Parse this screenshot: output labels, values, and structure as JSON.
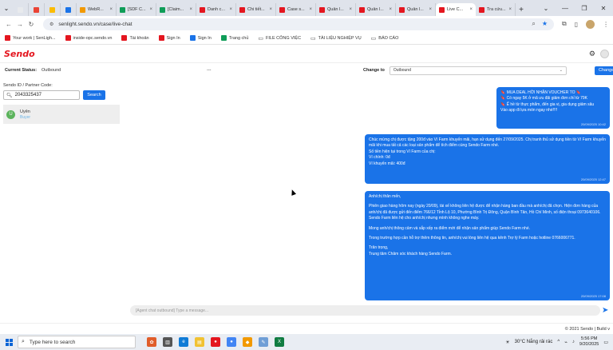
{
  "browser": {
    "tabs": [
      {
        "label": "",
        "color": "#e8eaed",
        "active": false
      },
      {
        "label": "",
        "color": "#ea4335",
        "active": false
      },
      {
        "label": "",
        "color": "#fbbc04",
        "active": false
      },
      {
        "label": "",
        "color": "#1a73e8",
        "active": false
      },
      {
        "label": "WebR...",
        "color": "#f29900",
        "active": false
      },
      {
        "label": "[SDF C...",
        "color": "#0f9d58",
        "active": false
      },
      {
        "label": "[Claim...",
        "color": "#0f9d58",
        "active": false
      },
      {
        "label": "Danh c...",
        "color": "#e4161f",
        "active": false
      },
      {
        "label": "Chi tiết...",
        "color": "#e4161f",
        "active": false
      },
      {
        "label": "Case s...",
        "color": "#e4161f",
        "active": false
      },
      {
        "label": "Quản l...",
        "color": "#e4161f",
        "active": false
      },
      {
        "label": "Quản l...",
        "color": "#e4161f",
        "active": false
      },
      {
        "label": "Quản l...",
        "color": "#e4161f",
        "active": false
      },
      {
        "label": "Live C...",
        "color": "#e4161f",
        "active": true
      },
      {
        "label": "Tra cứu...",
        "color": "#e4161f",
        "active": false
      }
    ],
    "url": "senlight.sendo.vn/case/live-chat",
    "bookmarks": [
      {
        "label": "Your work | SenLigh...",
        "color": "#e4161f",
        "type": "site"
      },
      {
        "label": "inside-opc.sendo.vn",
        "color": "#e4161f",
        "type": "site"
      },
      {
        "label": "Tài khoản",
        "color": "#e4161f",
        "type": "site"
      },
      {
        "label": "Sign In",
        "color": "#e4161f",
        "type": "site"
      },
      {
        "label": "Sign In",
        "color": "#1a73e8",
        "type": "site"
      },
      {
        "label": "Trang chủ",
        "color": "#0f9d58",
        "type": "site"
      },
      {
        "label": "FILE CÔNG VIỆC",
        "color": "#777777",
        "type": "folder"
      },
      {
        "label": "TÀI LIỆU NGHIỆP VỤ",
        "color": "#777777",
        "type": "folder"
      },
      {
        "label": "BÁO CÁO",
        "color": "#777777",
        "type": "folder"
      }
    ]
  },
  "app": {
    "logo": "Sendo",
    "current_status_label": "Current Status:",
    "current_status_value": "Outbound",
    "mid_placeholder": "---",
    "change_to_label": "Change to",
    "change_to_value": "Outbound",
    "change_button": "Change",
    "search": {
      "label": "Sendo ID / Partner Code:",
      "value": "2043325437",
      "button": "Search"
    },
    "contact": {
      "initial": "U",
      "name": "Uyên",
      "role": "Buyer"
    },
    "messages": [
      {
        "lines": [
          "🔖 MUA DEAL HỜI NHẬN VOUCHER TO 🔖",
          "🔖 Có ngay 5K ở mã ưu đãi giảm đơn chỉ từ 79K",
          "🔖 Ế hề từ thực phẩm, đến gia vị, gia dụng giảm sâu",
          "Vào app đi lựa món ngay nhé!!!!"
        ],
        "time": "20/09/2025 10:42"
      },
      {
        "lines": [
          "Chúc mừng chị được tặng 200đ vào Ví Farm khuyến mãi, hạn sử dụng đến 27/09/2025. Chị tranh thủ sử dụng tiền từ Ví Farm khuyến mãi khi mua tất cả các loại sản phẩm để tích điểm cùng Sendo Farm nhé.",
          "Số tiền hiện tại trong Ví Farm của chị:",
          "Ví chính: 0đ",
          "Ví khuyến mãi: 400đ"
        ],
        "time": "20/09/2025 12:47"
      },
      {
        "lines": [
          "Anh/chị thân mến,",
          "",
          "Phiên giao hàng hôm nay (ngày 20/09), tài xế không liên hệ được để nhận hàng ban đầu mà anh/chị đã chọn. Hiện đơn hàng của anh/chị đã được gửi đến điểm 766/12 Tỉnh Lộ 10, Phường Bình Trị Đông, Quận Bình Tân, Hồ Chí Minh, số điện thoại 0973640106. Sendo Farm liên hệ cho anh/chị nhưng mình không nghe máy.",
          "",
          "Mong anh/chị thông cảm và sắp xếp ra điểm mới để nhận sản phẩm giúp Sendo Farm nhé.",
          "",
          "Trong trường hợp cần hỗ trợ thêm thông tin, anh/chị vui lòng liên hệ qua kênh Trợ lý Farm hoặc hotline 0766006771.",
          "",
          "Trân trọng,",
          "Trung tâm Chăm sóc khách hàng Sendo Farm."
        ],
        "time": "20/09/2025 17:08"
      }
    ],
    "message_placeholder": "[Agent chat outbound] Type a message...",
    "footer": "© 2021 Sendo | Build v"
  },
  "taskbar": {
    "search_placeholder": "Type here to search",
    "weather": "30°C  Nắng rải rác",
    "time": "5:56 PM",
    "date": "9/20/2025"
  },
  "colors": {
    "accent": "#1a73e8",
    "brand": "#e4161f"
  }
}
